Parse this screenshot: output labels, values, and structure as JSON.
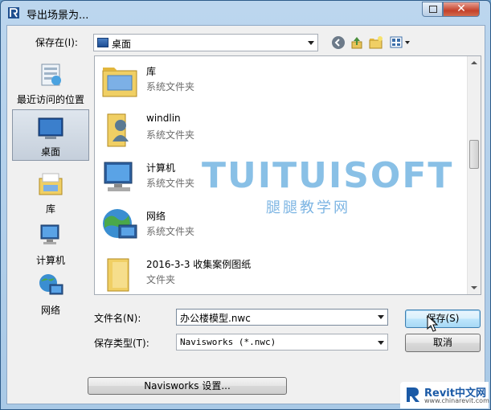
{
  "window": {
    "title": "导出场景为..."
  },
  "location": {
    "label": "保存在(I):",
    "value": "桌面"
  },
  "places": [
    {
      "label": "最近访问的位置",
      "icon": "recent-places-icon"
    },
    {
      "label": "桌面",
      "icon": "desktop-icon",
      "selected": true
    },
    {
      "label": "库",
      "icon": "libraries-icon"
    },
    {
      "label": "计算机",
      "icon": "computer-icon"
    },
    {
      "label": "网络",
      "icon": "network-icon"
    }
  ],
  "files": [
    {
      "name": "库",
      "type": "系统文件夹",
      "icon": "libraries-folder-icon"
    },
    {
      "name": "windlin",
      "type": "系统文件夹",
      "icon": "user-folder-icon"
    },
    {
      "name": "计算机",
      "type": "系统文件夹",
      "icon": "computer-icon"
    },
    {
      "name": "网络",
      "type": "系统文件夹",
      "icon": "network-icon"
    },
    {
      "name": "2016-3-3 收集案例图纸",
      "type": "文件夹",
      "icon": "folder-icon"
    }
  ],
  "filename": {
    "label": "文件名(N):",
    "value": "办公楼模型.nwc"
  },
  "filetype": {
    "label": "保存类型(T):",
    "value": "Navisworks (*.nwc)"
  },
  "buttons": {
    "save": "保存(S)",
    "cancel": "取消",
    "settings": "Navisworks 设置..."
  },
  "watermark": {
    "main": "TUITUISOFT",
    "sub": "腿腿教学网"
  },
  "badge": {
    "brand": "Revit中文网",
    "url": "www.chinarevit.com"
  },
  "colors": {
    "titlebar": "#bcd6ee",
    "close": "#c4412a",
    "accent": "#3c7fb1"
  }
}
